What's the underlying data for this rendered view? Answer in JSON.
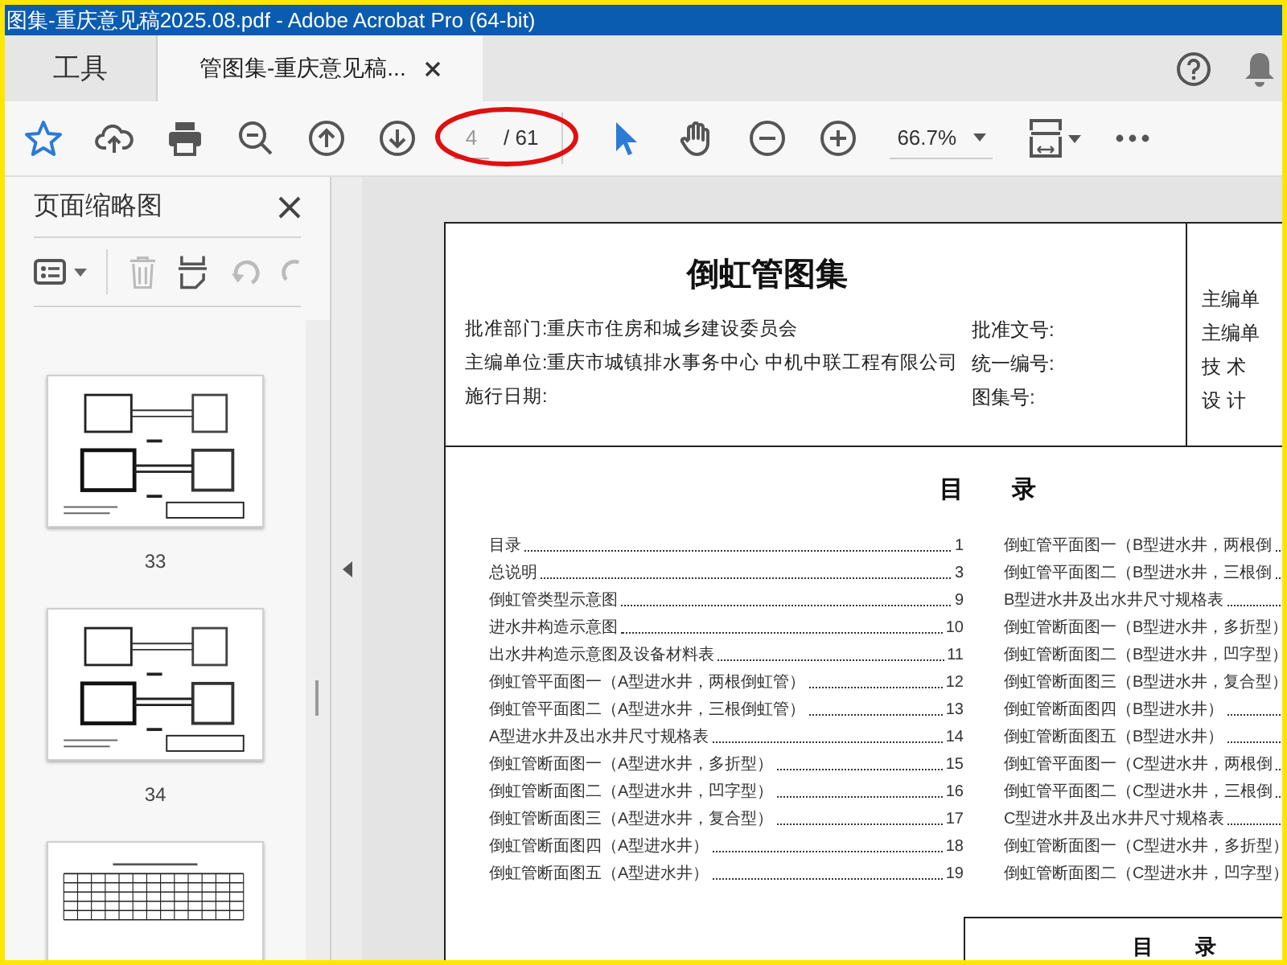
{
  "window": {
    "title": "图集-重庆意见稿2025.08.pdf - Adobe Acrobat Pro (64-bit)"
  },
  "tabs": [
    {
      "label": "工具",
      "kind": "tools",
      "selected": false
    },
    {
      "label": "管图集-重庆意见稿...",
      "kind": "document",
      "selected": true
    }
  ],
  "toolbar": {
    "page_number": "4",
    "page_count": "/ 61",
    "zoom": "66.7%"
  },
  "sidebar": {
    "title": "页面缩略图",
    "thumbnails": [
      {
        "label": "33",
        "kind": "drawing"
      },
      {
        "label": "34",
        "kind": "drawing"
      },
      {
        "kind": "table"
      }
    ]
  },
  "document": {
    "title": "倒虹管图集",
    "info_left": [
      "批准部门:重庆市住房和城乡建设委员会",
      "主编单位:重庆市城镇排水事务中心 中机中联工程有限公司",
      "施行日期:"
    ],
    "info_middle": [
      "批准文号:",
      "统一编号:",
      "图集号:"
    ],
    "info_right": [
      "主编单",
      "主编单",
      "技 术",
      "设 计"
    ],
    "toc_title": "目　　录",
    "toc_left": [
      {
        "title": "目录",
        "page": "1"
      },
      {
        "title": "总说明",
        "page": "3"
      },
      {
        "title": "倒虹管类型示意图",
        "page": "9"
      },
      {
        "title": "进水井构造示意图",
        "page": "10"
      },
      {
        "title": "出水井构造示意图及设备材料表",
        "page": "11"
      },
      {
        "title": "倒虹管平面图一（A型进水井，两根倒虹管）",
        "page": "12"
      },
      {
        "title": "倒虹管平面图二（A型进水井，三根倒虹管）",
        "page": "13"
      },
      {
        "title": "A型进水井及出水井尺寸规格表",
        "page": "14"
      },
      {
        "title": "倒虹管断面图一（A型进水井，多折型）",
        "page": "15"
      },
      {
        "title": "倒虹管断面图二（A型进水井，凹字型）",
        "page": "16"
      },
      {
        "title": "倒虹管断面图三（A型进水井，复合型）",
        "page": "17"
      },
      {
        "title": "倒虹管断面图四（A型进水井）",
        "page": "18"
      },
      {
        "title": "倒虹管断面图五（A型进水井）",
        "page": "19"
      }
    ],
    "toc_right": [
      {
        "title": "倒虹管平面图一（B型进水井，两根倒"
      },
      {
        "title": "倒虹管平面图二（B型进水井，三根倒"
      },
      {
        "title": "B型进水井及出水井尺寸规格表"
      },
      {
        "title": "倒虹管断面图一（B型进水井，多折型）"
      },
      {
        "title": "倒虹管断面图二（B型进水井，凹字型）"
      },
      {
        "title": "倒虹管断面图三（B型进水井，复合型）"
      },
      {
        "title": "倒虹管断面图四（B型进水井）"
      },
      {
        "title": "倒虹管断面图五（B型进水井）"
      },
      {
        "title": "倒虹管平面图一（C型进水井，两根倒"
      },
      {
        "title": "倒虹管平面图二（C型进水井，三根倒"
      },
      {
        "title": "C型进水井及出水井尺寸规格表"
      },
      {
        "title": "倒虹管断面图一（C型进水井，多折型）"
      },
      {
        "title": "倒虹管断面图二（C型进水井，凹字型）"
      }
    ],
    "footer_box": "目　　录"
  }
}
